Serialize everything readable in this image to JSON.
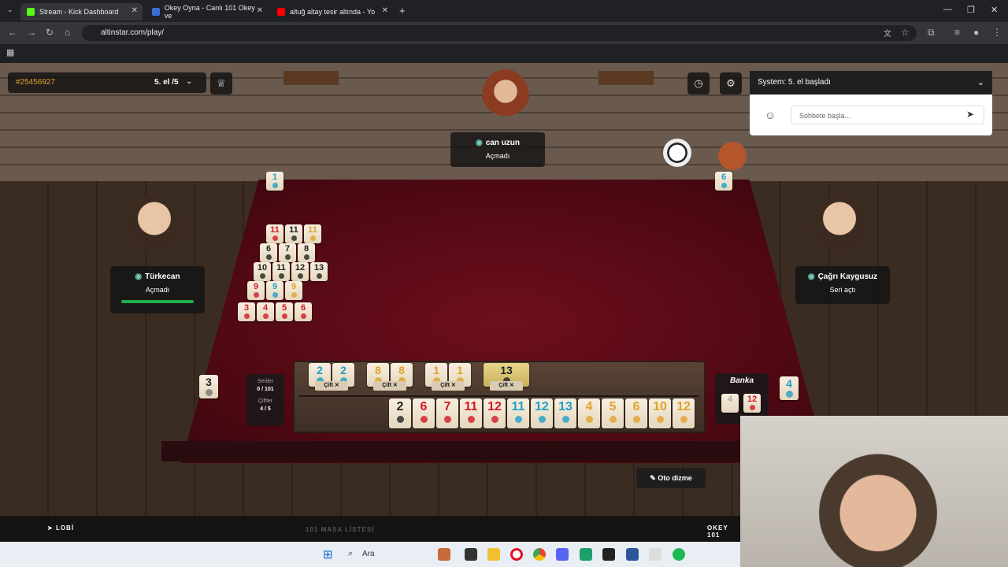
{
  "tabs": [
    {
      "label": "Stream - Kick Dashboard",
      "fav": "#53fc18"
    },
    {
      "label": "Okey Oyna - Canlı 101 Okey ve",
      "fav": "#3b6fd6"
    },
    {
      "label": "altuğ altay tesir altında - Yo",
      "fav": "#ff0000"
    }
  ],
  "browser": {
    "url": "altinstar.com/play/"
  },
  "game": {
    "table_id": "#25456927",
    "round": "5. el /5",
    "players": {
      "top": {
        "name": "can uzun",
        "status": "Açmadı"
      },
      "left": {
        "name": "Türkecan",
        "status": "Açmadı"
      },
      "right": {
        "name": "Çağrı Kaygusuz",
        "status": "Seri açtı"
      }
    },
    "indicators": {
      "top_left": "1",
      "top_right": "6",
      "deck_count": "3",
      "banka_right": "4"
    },
    "stats": {
      "seriler_label": "Seriler",
      "seriler_value": "0 / 101",
      "ciftler_label": "Çiftler",
      "ciftler_value": "4 / 5"
    },
    "banka": {
      "label": "Banka",
      "tiles": [
        "4",
        "12"
      ]
    },
    "pair_label": "Çift ✕",
    "oto_dizme": "Oto dizme",
    "lobi": "LOBİ",
    "masa_listesi": "101 MASA LİSTESİ",
    "okey101": "OKEY 101"
  },
  "chat": {
    "system_message": "System: 5. el başladı",
    "placeholder": "Sohbete başla..."
  },
  "taskbar": {
    "search": "Ara"
  },
  "rack_pairs": [
    {
      "tiles": [
        "2",
        "2"
      ],
      "color": "blu"
    },
    {
      "tiles": [
        "8",
        "8"
      ],
      "color": "yel"
    },
    {
      "tiles": [
        "1",
        "1"
      ],
      "color": "yel"
    },
    {
      "tiles": [
        "13"
      ],
      "color": "blk"
    }
  ],
  "rack_row": [
    {
      "n": "2",
      "c": "blk"
    },
    {
      "n": "6",
      "c": "red"
    },
    {
      "n": "7",
      "c": "red"
    },
    {
      "n": "11",
      "c": "red"
    },
    {
      "n": "12",
      "c": "red"
    },
    {
      "n": "11",
      "c": "blu"
    },
    {
      "n": "12",
      "c": "blu"
    },
    {
      "n": "13",
      "c": "blu"
    },
    {
      "n": "4",
      "c": "yel"
    },
    {
      "n": "5",
      "c": "yel"
    },
    {
      "n": "6",
      "c": "yel"
    },
    {
      "n": "10",
      "c": "yel"
    },
    {
      "n": "12",
      "c": "yel"
    }
  ],
  "opened_sets": [
    [
      {
        "n": "11",
        "c": "red"
      },
      {
        "n": "11",
        "c": "blk"
      },
      {
        "n": "11",
        "c": "yel"
      }
    ],
    [
      {
        "n": "6",
        "c": "blk"
      },
      {
        "n": "7",
        "c": "blk"
      },
      {
        "n": "8",
        "c": "blk"
      }
    ],
    [
      {
        "n": "10",
        "c": "blk"
      },
      {
        "n": "11",
        "c": "blk"
      },
      {
        "n": "12",
        "c": "blk"
      },
      {
        "n": "13",
        "c": "blk"
      }
    ],
    [
      {
        "n": "9",
        "c": "red"
      },
      {
        "n": "9",
        "c": "blu"
      },
      {
        "n": "9",
        "c": "yel"
      }
    ],
    [
      {
        "n": "3",
        "c": "red"
      },
      {
        "n": "4",
        "c": "red"
      },
      {
        "n": "5",
        "c": "red"
      },
      {
        "n": "6",
        "c": "red"
      }
    ]
  ],
  "colors": {
    "red": "#d31828",
    "black": "#222222",
    "blue": "#1ea0c8",
    "yellow": "#e0a22b",
    "felt": "#6e0f1c"
  }
}
